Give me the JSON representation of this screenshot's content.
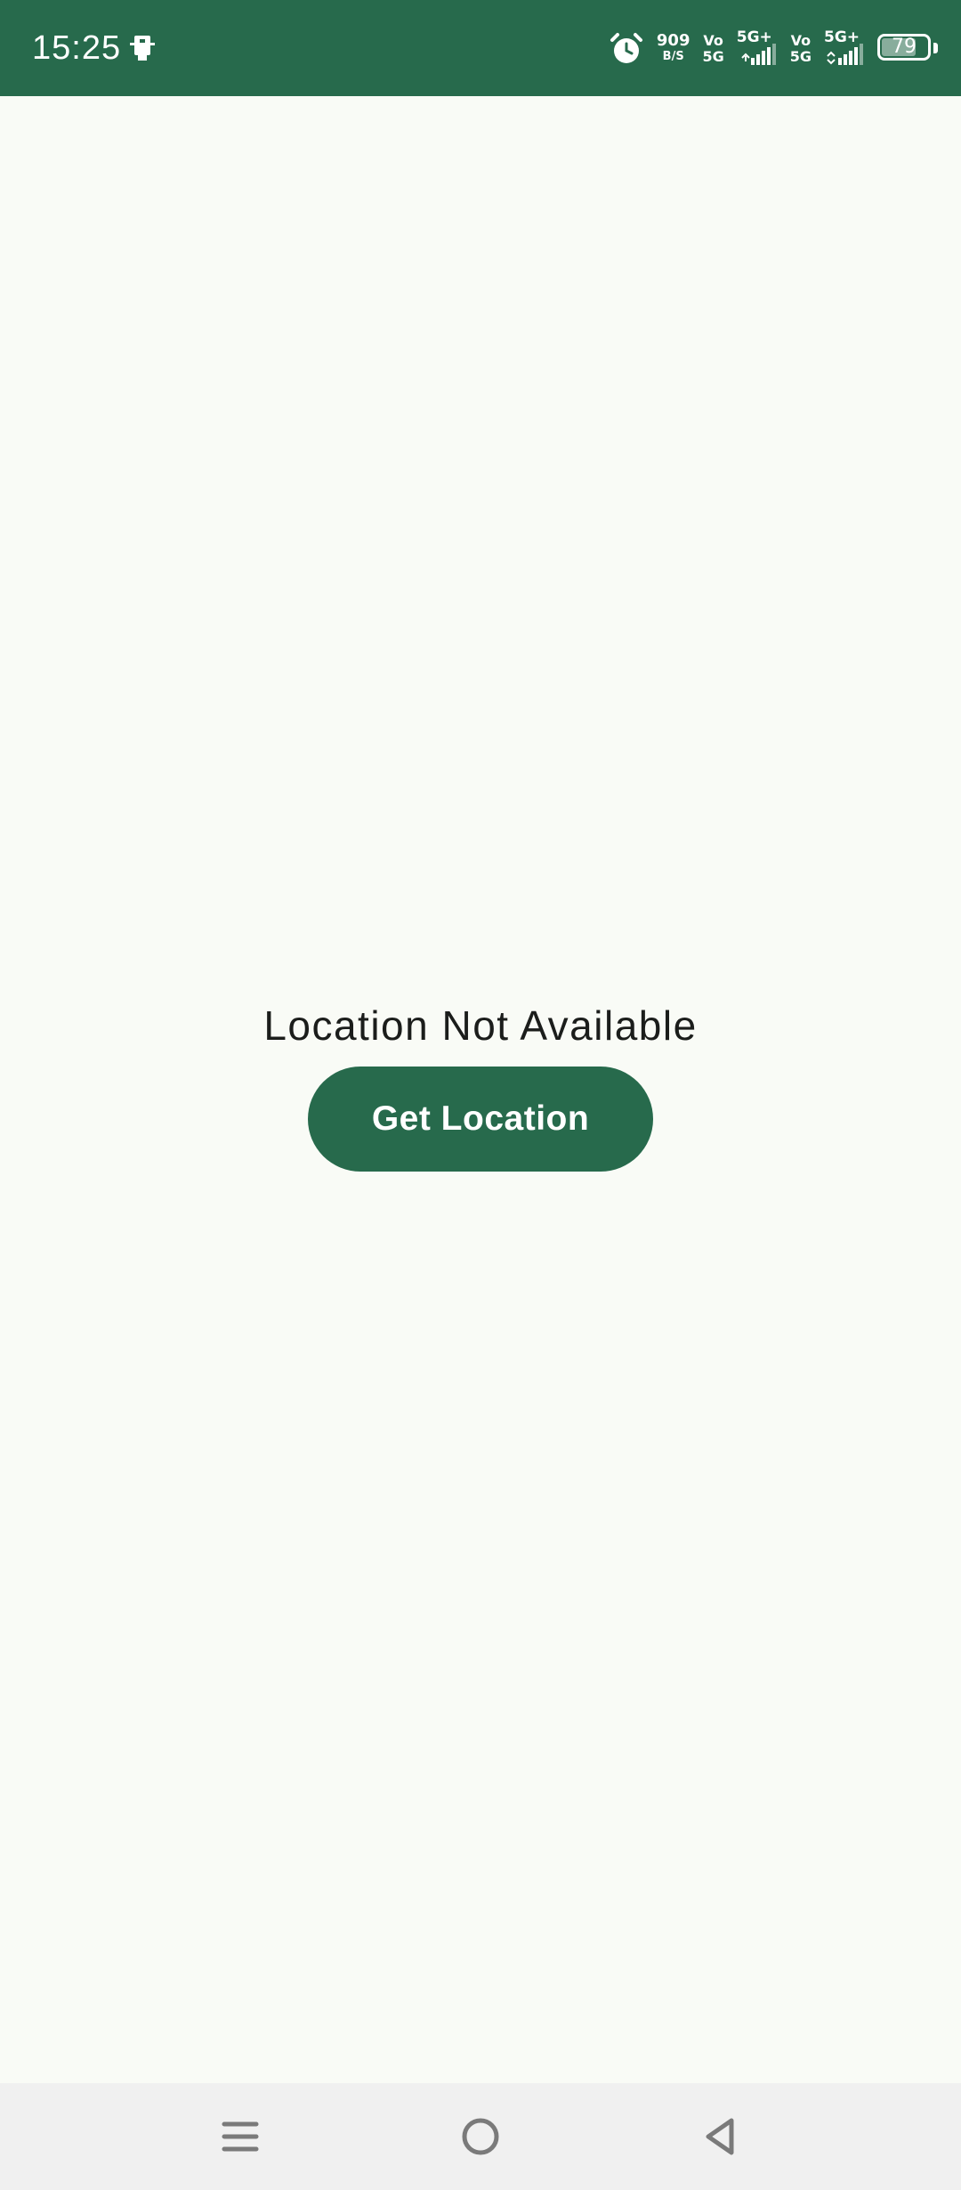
{
  "status_bar": {
    "time": "15:25",
    "net_speed_value": "909",
    "net_speed_unit": "B/S",
    "volte_1_top": "Vo",
    "volte_1_bottom": "5G",
    "sim1_tech": "5G+",
    "volte_2_top": "Vo",
    "volte_2_bottom": "5G",
    "sim2_tech": "5G+",
    "battery_level": "79",
    "background_color": "#276a4c",
    "icons": [
      "notification-icon",
      "alarm-icon",
      "signal-icon",
      "signal-icon",
      "battery-icon"
    ]
  },
  "main": {
    "status_text": "Location Not Available",
    "button_label": "Get Location",
    "accent_color": "#276a4c",
    "background_color": "#f9fbf6"
  },
  "nav_bar": {
    "icons": [
      "recents-icon",
      "home-icon",
      "back-icon"
    ]
  }
}
